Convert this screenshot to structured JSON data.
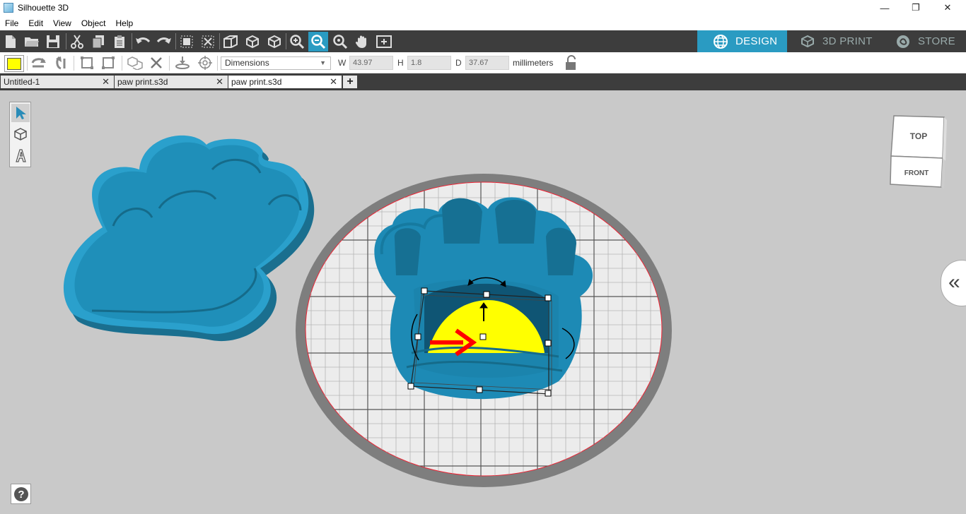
{
  "window": {
    "title": "Silhouette 3D"
  },
  "menu": [
    "File",
    "Edit",
    "View",
    "Object",
    "Help"
  ],
  "mode_tabs": {
    "design": "DESIGN",
    "print3d": "3D PRINT",
    "store": "STORE"
  },
  "options": {
    "dimensions_mode": "Dimensions",
    "w_label": "W",
    "w_value": "43.97",
    "h_label": "H",
    "h_value": "1.8",
    "d_label": "D",
    "d_value": "37.67",
    "units": "millimeters"
  },
  "doc_tabs": [
    "Untitled-1",
    "paw print.s3d",
    "paw print.s3d"
  ],
  "view_cube": {
    "top": "TOP",
    "front": "FRONT"
  },
  "help": "?",
  "side_toggle": "«",
  "colors": {
    "accent": "#2a9bc2",
    "model": "#2298c8",
    "selection_fill": "#ffff00",
    "arrow": "#ff0000"
  }
}
